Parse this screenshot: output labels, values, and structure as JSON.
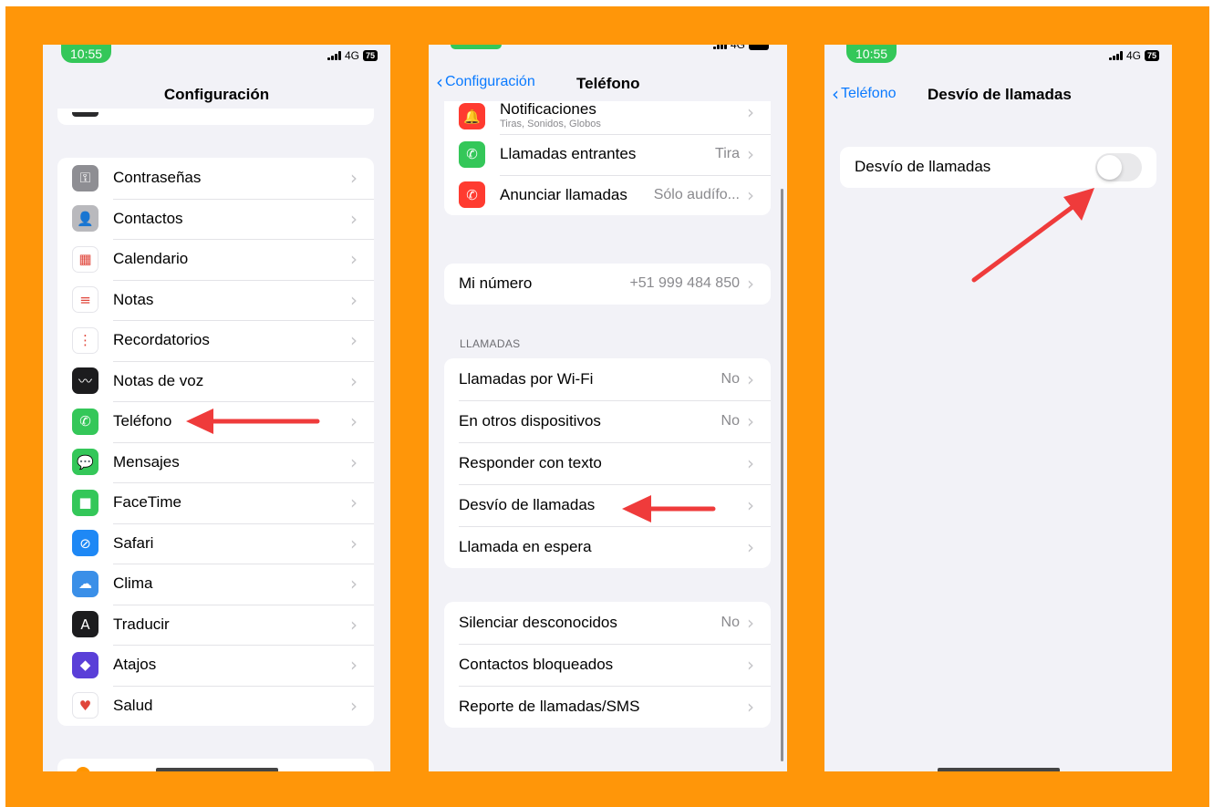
{
  "colors": {
    "background_frame": "#ff9609",
    "ios_blue": "#0a7aff",
    "annotation_red": "#ef3b3b",
    "status_green": "#34c759"
  },
  "screen1": {
    "status": {
      "time": "10:55",
      "network": "4G",
      "battery": "75"
    },
    "nav_title": "Configuración",
    "items": [
      {
        "label": "Contraseñas",
        "icon": "key-icon",
        "color": "#8e8e93",
        "glyph": "⚿"
      },
      {
        "label": "Contactos",
        "icon": "contacts-icon",
        "color": "#b9b9bd",
        "glyph": "👤"
      },
      {
        "label": "Calendario",
        "icon": "calendar-icon",
        "color": "#ffffff",
        "glyph": "▦"
      },
      {
        "label": "Notas",
        "icon": "notes-icon",
        "color": "#ffffff",
        "glyph": "≡"
      },
      {
        "label": "Recordatorios",
        "icon": "reminders-icon",
        "color": "#ffffff",
        "glyph": "⋮"
      },
      {
        "label": "Notas de voz",
        "icon": "voice-memos-icon",
        "color": "#1c1c1e",
        "glyph": "〰"
      },
      {
        "label": "Teléfono",
        "icon": "phone-icon",
        "color": "#34c759",
        "glyph": "✆"
      },
      {
        "label": "Mensajes",
        "icon": "messages-icon",
        "color": "#34c759",
        "glyph": "💬"
      },
      {
        "label": "FaceTime",
        "icon": "facetime-icon",
        "color": "#34c759",
        "glyph": "■"
      },
      {
        "label": "Safari",
        "icon": "safari-icon",
        "color": "#1e88f5",
        "glyph": "⊘"
      },
      {
        "label": "Clima",
        "icon": "weather-icon",
        "color": "#3a8fe8",
        "glyph": "☁"
      },
      {
        "label": "Traducir",
        "icon": "translate-icon",
        "color": "#1c1c1e",
        "glyph": "A"
      },
      {
        "label": "Atajos",
        "icon": "shortcuts-icon",
        "color": "#5a3fd8",
        "glyph": "◆"
      },
      {
        "label": "Salud",
        "icon": "health-icon",
        "color": "#ffffff",
        "glyph": "♥"
      }
    ]
  },
  "screen2": {
    "status": {
      "network": "4G"
    },
    "back_label": "Configuración",
    "nav_title": "Teléfono",
    "group_top": [
      {
        "label": "Notificaciones",
        "sublabel": "Tiras, Sonidos, Globos",
        "value": "",
        "icon": "notifications-icon",
        "color": "#ff3b30",
        "glyph": "🔔"
      },
      {
        "label": "Llamadas entrantes",
        "value": "Tira",
        "icon": "incoming-calls-icon",
        "color": "#34c759",
        "glyph": "✆"
      },
      {
        "label": "Anunciar llamadas",
        "value": "Sólo audífo...",
        "icon": "announce-calls-icon",
        "color": "#ff3b30",
        "glyph": "✆"
      }
    ],
    "my_number": {
      "label": "Mi número",
      "value": "+51 999 484 850"
    },
    "section_header": "LLAMADAS",
    "calls_group": [
      {
        "label": "Llamadas por Wi-Fi",
        "value": "No"
      },
      {
        "label": "En otros dispositivos",
        "value": "No"
      },
      {
        "label": "Responder con texto",
        "value": ""
      },
      {
        "label": "Desvío de llamadas",
        "value": ""
      },
      {
        "label": "Llamada en espera",
        "value": ""
      }
    ],
    "bottom_group": [
      {
        "label": "Silenciar desconocidos",
        "value": "No"
      },
      {
        "label": "Contactos bloqueados",
        "value": ""
      },
      {
        "label": "Reporte de llamadas/SMS",
        "value": ""
      }
    ]
  },
  "screen3": {
    "status": {
      "time": "10:55",
      "network": "4G",
      "battery": "75"
    },
    "back_label": "Teléfono",
    "nav_title": "Desvío de llamadas",
    "toggle": {
      "label": "Desvío de llamadas",
      "on": false
    }
  }
}
